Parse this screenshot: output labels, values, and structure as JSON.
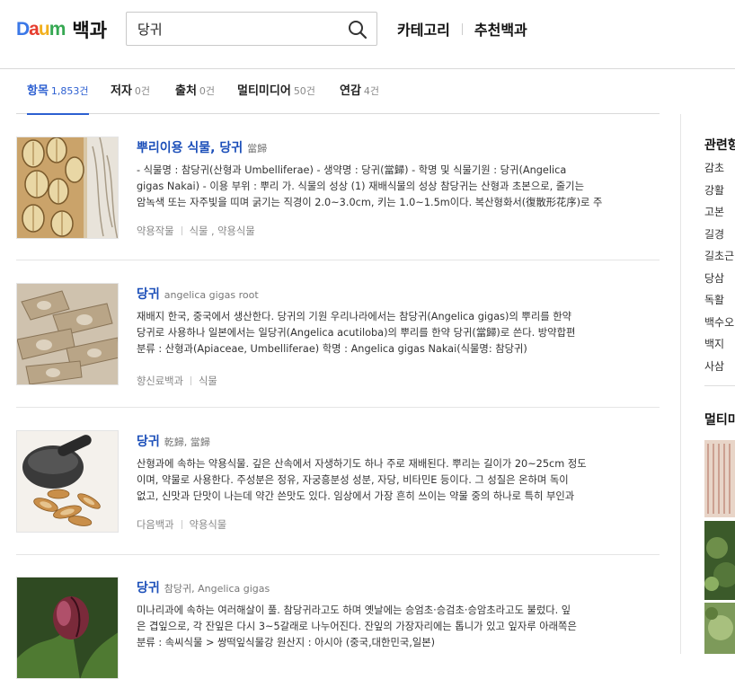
{
  "header": {
    "logo_text": "Daum",
    "logo_title": "백과",
    "search_value": "당귀",
    "nav": [
      "카테고리",
      "추천백과"
    ]
  },
  "tabs": [
    {
      "label": "항목",
      "count": "1,853건",
      "active": true
    },
    {
      "label": "저자",
      "count": "0건"
    },
    {
      "label": "출처",
      "count": "0건"
    },
    {
      "label": "멀티미디어",
      "count": "50건"
    },
    {
      "label": "연감",
      "count": "4건"
    }
  ],
  "results": [
    {
      "title": "뿌리이용 식물, 당귀",
      "subtitle": "當歸",
      "desc_line1": "- 식물명 : 참당귀(산형과 Umbelliferae) - 생약명 : 당귀(當歸) - 학명 및 식물기원 : 당귀(Angelica",
      "desc_line2": "gigas Nakai) - 이용 부위 : 뿌리 가. 식물의 성상 (1) 재배식물의 성상 참당귀는 산형과 초본으로, 줄기는",
      "desc_line3": "암녹색 또는 자주빛을 띠며 굵기는 직경이 2.0~3.0cm, 키는 1.0~1.5m이다. 복산형화서(復散形花序)로 주",
      "meta": [
        "약용작물",
        "식물 , 약용식물"
      ]
    },
    {
      "title": "당귀",
      "subtitle": "angelica gigas root",
      "desc_line1": "재배지 한국, 중국에서 생산한다. 당귀의 기원 우리나라에서는 참당귀(Angelica gigas)의 뿌리를 한약",
      "desc_line2": "당귀로 사용하나 일본에서는 일당귀(Angelica acutiloba)의 뿌리를 한약 당귀(當歸)로 쓴다. 방약합편",
      "desc_line3": "분류 : 산형과(Apiaceae, Umbelliferae)   학명 : Angelica gigas Nakai(식물명: 참당귀)",
      "meta": [
        "향신료백과",
        "식물"
      ]
    },
    {
      "title": "당귀",
      "subtitle": "乾歸, 當歸",
      "desc_line1": "산형과에 속하는 약용식물. 깊은 산속에서 자생하기도 하나 주로 재배된다. 뿌리는 길이가 20~25cm 정도",
      "desc_line2": "이며, 약물로 사용한다. 주성분은 정유, 자궁흥분성 성분, 자당, 비타민E 등이다. 그 성질은 온하며 독이",
      "desc_line3": "없고, 신맛과 단맛이 나는데 약간 쓴맛도 있다. 임상에서 가장 흔히 쓰이는 약물 중의 하나로 특히 부인과",
      "meta": [
        "다음백과",
        "약용식물"
      ]
    },
    {
      "title": "당귀",
      "subtitle": "참당귀, Angelica gigas",
      "desc_line1": "미나리과에 속하는 여러해살이 풀. 참당귀라고도 하며 옛날에는 승엄초·승검초·승암초라고도 불렀다. 잎",
      "desc_line2": "은 겹잎으로, 각 잔잎은 다시 3~5갈래로 나누어진다. 잔잎의 가장자리에는 톱니가 있고 잎자루 아래쪽은",
      "desc_line3": "분류 : 속씨식물 > 쌍떡잎식물강   원산지 : 아시아 (중국,대한민국,일본)"
    }
  ],
  "sidebar": {
    "related_heading": "관련항목",
    "related_items": [
      "감초",
      "강활",
      "고본",
      "길경",
      "길초근",
      "당삼",
      "독활",
      "백수오",
      "백지",
      "사삼"
    ],
    "media_heading": "멀티미디어"
  }
}
